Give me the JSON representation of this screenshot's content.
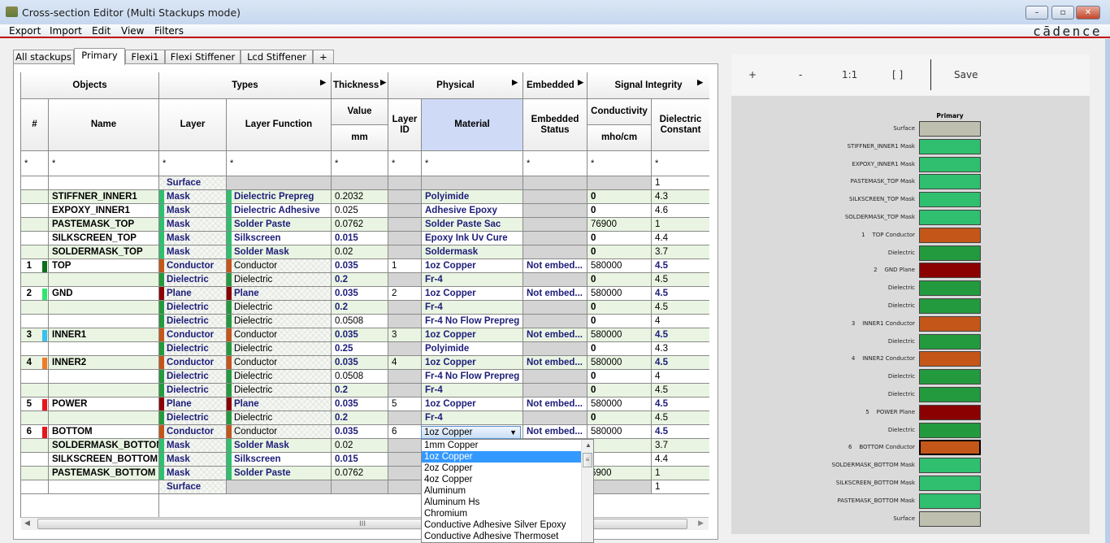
{
  "window": {
    "title": "Cross-section Editor (Multi Stackups mode)",
    "controls": {
      "minimize": "–",
      "maximize": "▫",
      "close": "✕"
    }
  },
  "menubar": {
    "items": [
      "Export",
      "Import",
      "Edit",
      "View",
      "Filters"
    ],
    "brand": "cādence"
  },
  "tabs": [
    {
      "label": "All stackups",
      "active": false
    },
    {
      "label": "Primary",
      "active": true
    },
    {
      "label": "Flexi1",
      "active": false
    },
    {
      "label": "Flexi Stiffener",
      "active": false
    },
    {
      "label": "Lcd Stiffener",
      "active": false
    },
    {
      "label": "+",
      "active": false
    }
  ],
  "table": {
    "groups": {
      "objects": "Objects",
      "types": "Types",
      "thickness": "Thickness",
      "physical": "Physical",
      "embedded": "Embedded",
      "signal_integrity": "Signal Integrity"
    },
    "columns": {
      "num": "#",
      "name": "Name",
      "layer": "Layer",
      "layer_function": "Layer Function",
      "value": "Value",
      "value_unit": "mm",
      "layer_id": "Layer ID",
      "material": "Material",
      "embedded_status": "Embedded Status",
      "conductivity": "Conductivity",
      "conductivity_unit": "mho/cm",
      "dielectric_constant": "Dielectric Constant"
    },
    "filter_value": "*",
    "rows": [
      {
        "num": "",
        "name": "",
        "layer": "Surface",
        "layer_function": "",
        "thickness": "",
        "layer_id": "",
        "material": "",
        "embedded": "",
        "conductivity": "",
        "dk": "1"
      },
      {
        "num": "",
        "name": "STIFFNER_INNER1",
        "layer": "Mask",
        "layer_function": "Dielectric Prepreg",
        "thickness": "0.2032",
        "layer_id": "",
        "material": "Polyimide",
        "embedded": "",
        "conductivity": "0",
        "dk": "4.3"
      },
      {
        "num": "",
        "name": "EXPOXY_INNER1",
        "layer": "Mask",
        "layer_function": "Dielectric Adhesive",
        "thickness": "0.025",
        "layer_id": "",
        "material": "Adhesive Epoxy",
        "embedded": "",
        "conductivity": "0",
        "dk": "4.6"
      },
      {
        "num": "",
        "name": "PASTEMASK_TOP",
        "layer": "Mask",
        "layer_function": "Solder Paste",
        "thickness": "0.0762",
        "layer_id": "",
        "material": "Solder Paste Sac",
        "embedded": "",
        "conductivity": "76900",
        "dk": "1"
      },
      {
        "num": "",
        "name": "SILKSCREEN_TOP",
        "layer": "Mask",
        "layer_function": "Silkscreen",
        "thickness": "0.015",
        "layer_id": "",
        "material": "Epoxy Ink Uv Cure",
        "embedded": "",
        "conductivity": "0",
        "dk": "4.4"
      },
      {
        "num": "",
        "name": "SOLDERMASK_TOP",
        "layer": "Mask",
        "layer_function": "Solder Mask",
        "thickness": "0.02",
        "layer_id": "",
        "material": "Soldermask",
        "embedded": "",
        "conductivity": "0",
        "dk": "3.7"
      },
      {
        "num": "1",
        "name": "TOP",
        "layer": "Conductor",
        "layer_function": "Conductor",
        "thickness": "0.035",
        "layer_id": "1",
        "material": "1oz Copper",
        "embedded": "Not embed...",
        "conductivity": "580000",
        "dk": "4.5",
        "num_color": "#0b6e1a"
      },
      {
        "num": "",
        "name": "",
        "layer": "Dielectric",
        "layer_function": "Dielectric",
        "thickness": "0.2",
        "layer_id": "",
        "material": "Fr-4",
        "embedded": "",
        "conductivity": "0",
        "dk": "4.5"
      },
      {
        "num": "2",
        "name": "GND",
        "layer": "Plane",
        "layer_function": "Plane",
        "thickness": "0.035",
        "layer_id": "2",
        "material": "1oz Copper",
        "embedded": "Not embed...",
        "conductivity": "580000",
        "dk": "4.5",
        "num_color": "#2ee86e"
      },
      {
        "num": "",
        "name": "",
        "layer": "Dielectric",
        "layer_function": "Dielectric",
        "thickness": "0.2",
        "layer_id": "",
        "material": "Fr-4",
        "embedded": "",
        "conductivity": "0",
        "dk": "4.5"
      },
      {
        "num": "",
        "name": "",
        "layer": "Dielectric",
        "layer_function": "Dielectric",
        "thickness": "0.0508",
        "layer_id": "",
        "material": "Fr-4 No Flow Prepreg",
        "embedded": "",
        "conductivity": "0",
        "dk": "4"
      },
      {
        "num": "3",
        "name": "INNER1",
        "layer": "Conductor",
        "layer_function": "Conductor",
        "thickness": "0.035",
        "layer_id": "3",
        "material": "1oz Copper",
        "embedded": "Not embed...",
        "conductivity": "580000",
        "dk": "4.5",
        "num_color": "#38c0f0"
      },
      {
        "num": "",
        "name": "",
        "layer": "Dielectric",
        "layer_function": "Dielectric",
        "thickness": "0.25",
        "layer_id": "",
        "material": "Polyimide",
        "embedded": "",
        "conductivity": "0",
        "dk": "4.3"
      },
      {
        "num": "4",
        "name": "INNER2",
        "layer": "Conductor",
        "layer_function": "Conductor",
        "thickness": "0.035",
        "layer_id": "4",
        "material": "1oz Copper",
        "embedded": "Not embed...",
        "conductivity": "580000",
        "dk": "4.5",
        "num_color": "#f07a2a"
      },
      {
        "num": "",
        "name": "",
        "layer": "Dielectric",
        "layer_function": "Dielectric",
        "thickness": "0.0508",
        "layer_id": "",
        "material": "Fr-4 No Flow Prepreg",
        "embedded": "",
        "conductivity": "0",
        "dk": "4"
      },
      {
        "num": "",
        "name": "",
        "layer": "Dielectric",
        "layer_function": "Dielectric",
        "thickness": "0.2",
        "layer_id": "",
        "material": "Fr-4",
        "embedded": "",
        "conductivity": "0",
        "dk": "4.5"
      },
      {
        "num": "5",
        "name": "POWER",
        "layer": "Plane",
        "layer_function": "Plane",
        "thickness": "0.035",
        "layer_id": "5",
        "material": "1oz Copper",
        "embedded": "Not embed...",
        "conductivity": "580000",
        "dk": "4.5",
        "num_color": "#e8161a"
      },
      {
        "num": "",
        "name": "",
        "layer": "Dielectric",
        "layer_function": "Dielectric",
        "thickness": "0.2",
        "layer_id": "",
        "material": "Fr-4",
        "embedded": "",
        "conductivity": "0",
        "dk": "4.5"
      },
      {
        "num": "6",
        "name": "BOTTOM",
        "layer": "Conductor",
        "layer_function": "Conductor",
        "thickness": "0.035",
        "layer_id": "6",
        "material": "1oz Copper",
        "embedded": "Not embed...",
        "conductivity": "580000",
        "dk": "4.5",
        "num_color": "#e8161a"
      },
      {
        "num": "",
        "name": "SOLDERMASK_BOTTOM",
        "layer": "Mask",
        "layer_function": "Solder Mask",
        "thickness": "0.02",
        "layer_id": "",
        "material": "",
        "embedded": "",
        "conductivity": "",
        "dk": "3.7"
      },
      {
        "num": "",
        "name": "SILKSCREEN_BOTTOM",
        "layer": "Mask",
        "layer_function": "Silkscreen",
        "thickness": "0.015",
        "layer_id": "",
        "material": "",
        "embedded": "",
        "conductivity": "",
        "dk": "4.4"
      },
      {
        "num": "",
        "name": "PASTEMASK_BOTTOM",
        "layer": "Mask",
        "layer_function": "Solder Paste",
        "thickness": "0.0762",
        "layer_id": "",
        "material": "",
        "embedded": "",
        "conductivity": "6900",
        "dk": "1"
      },
      {
        "num": "",
        "name": "",
        "layer": "Surface",
        "layer_function": "",
        "thickness": "",
        "layer_id": "",
        "material": "",
        "embedded": "",
        "conductivity": "",
        "dk": "1"
      }
    ]
  },
  "material_dropdown": {
    "selected": "1oz Copper",
    "options": [
      "1mm Copper",
      "1oz Copper",
      "2oz Copper",
      "4oz Copper",
      "Aluminum",
      "Aluminum Hs",
      "Chromium",
      "Conductive Adhesive Silver Epoxy",
      "Conductive Adhesive Thermoset"
    ],
    "highlighted": "1oz Copper"
  },
  "layer_colors": {
    "Mask": "#2fbf6f",
    "Conductor": "#c4561a",
    "Plane": "#8b0000",
    "Dielectric": "#239a3e",
    "Surface": "#bfbfb0"
  },
  "viewer": {
    "toolbar": {
      "zoom_in": "+",
      "zoom_out": "-",
      "actual_size": "1:1",
      "fit": "[ ]",
      "save": "Save"
    },
    "column_title": "Primary",
    "layers": [
      {
        "label": "Surface",
        "type": "Surface"
      },
      {
        "label": "STIFFNER_INNER1 Mask",
        "type": "Mask"
      },
      {
        "label": "EXPOXY_INNER1 Mask",
        "type": "Mask"
      },
      {
        "label": "PASTEMASK_TOP Mask",
        "type": "Mask"
      },
      {
        "label": "SILKSCREEN_TOP Mask",
        "type": "Mask"
      },
      {
        "label": "SOLDERMASK_TOP Mask",
        "type": "Mask"
      },
      {
        "label": "1    TOP Conductor",
        "type": "Conductor"
      },
      {
        "label": "Dielectric",
        "type": "Dielectric"
      },
      {
        "label": "2    GND Plane",
        "type": "Plane"
      },
      {
        "label": "Dielectric",
        "type": "Dielectric"
      },
      {
        "label": "Dielectric",
        "type": "Dielectric"
      },
      {
        "label": "3    INNER1 Conductor",
        "type": "Conductor"
      },
      {
        "label": "Dielectric",
        "type": "Dielectric"
      },
      {
        "label": "4    INNER2 Conductor",
        "type": "Conductor"
      },
      {
        "label": "Dielectric",
        "type": "Dielectric"
      },
      {
        "label": "Dielectric",
        "type": "Dielectric"
      },
      {
        "label": "5    POWER Plane",
        "type": "Plane"
      },
      {
        "label": "Dielectric",
        "type": "Dielectric"
      },
      {
        "label": "6    BOTTOM Conductor",
        "type": "Conductor",
        "selected": true
      },
      {
        "label": "SOLDERMASK_BOTTOM Mask",
        "type": "Mask"
      },
      {
        "label": "SILKSCREEN_BOTTOM Mask",
        "type": "Mask"
      },
      {
        "label": "PASTEMASK_BOTTOM Mask",
        "type": "Mask"
      },
      {
        "label": "Surface",
        "type": "Surface"
      }
    ]
  }
}
